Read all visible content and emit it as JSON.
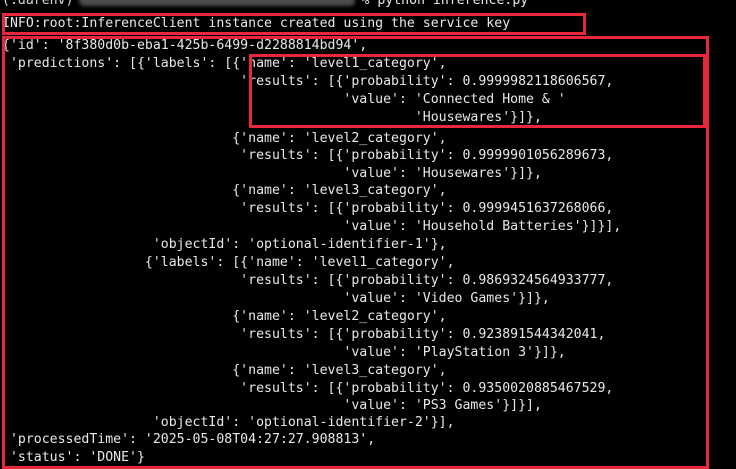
{
  "terminal": {
    "prompt_env": "(.darenv)",
    "prompt_cmd": "% python inference.py",
    "lines": [
      "INFO:root:InferenceClient instance created using the service key",
      "{'id': '8f380d0b-eba1-425b-6499-d2288814bd94',",
      " 'predictions': [{'labels': [{'name': 'level1_category',",
      "                              'results': [{'probability': 0.9999982118606567,",
      "                                           'value': 'Connected Home & '",
      "                                                    'Housewares'}]},",
      "                             {'name': 'level2_category',",
      "                              'results': [{'probability': 0.9999901056289673,",
      "                                           'value': 'Housewares'}]},",
      "                             {'name': 'level3_category',",
      "                              'results': [{'probability': 0.9999451637268066,",
      "                                           'value': 'Household Batteries'}]}],",
      "                   'objectId': 'optional-identifier-1'},",
      "                  {'labels': [{'name': 'level1_category',",
      "                              'results': [{'probability': 0.9869324564933777,",
      "                                           'value': 'Video Games'}]},",
      "                             {'name': 'level2_category',",
      "                              'results': [{'probability': 0.923891544342041,",
      "                                           'value': 'PlayStation 3'}]},",
      "                             {'name': 'level3_category',",
      "                              'results': [{'probability': 0.9350020885467529,",
      "                                           'value': 'PS3 Games'}]}],",
      "                   'objectId': 'optional-identifier-2'}],",
      " 'processedTime': '2025-05-08T04:27:27.908813',",
      " 'status': 'DONE'}"
    ]
  },
  "colors": {
    "background": "#000000",
    "text": "#e8e8e8",
    "highlight": "#e8283a"
  }
}
